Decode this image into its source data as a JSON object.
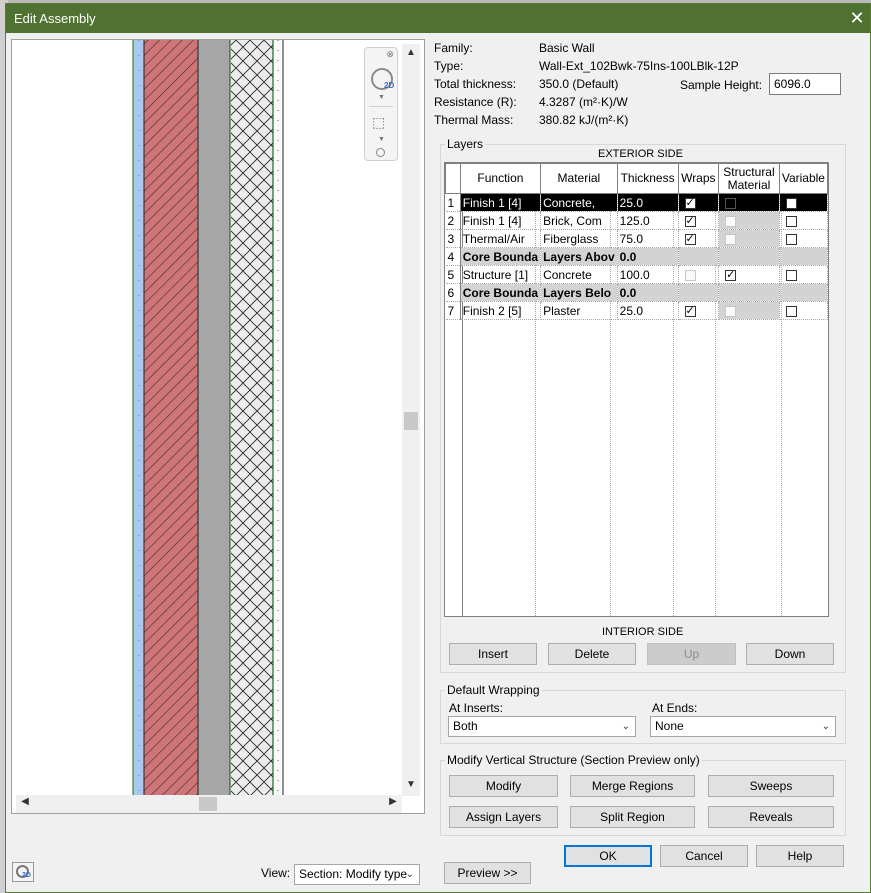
{
  "dialog": {
    "title": "Edit Assembly",
    "close_glyph": "✕"
  },
  "properties": {
    "family_label": "Family:",
    "family_value": "Basic Wall",
    "type_label": "Type:",
    "type_value": "Wall-Ext_102Bwk-75Ins-100LBlk-12P",
    "thickness_label": "Total thickness:",
    "thickness_value": "350.0 (Default)",
    "resistance_label": "Resistance (R):",
    "resistance_value": "4.3287 (m²·K)/W",
    "mass_label": "Thermal Mass:",
    "mass_value": "380.82 kJ/(m²·K)",
    "sample_height_label": "Sample Height:",
    "sample_height_value": "6096.0"
  },
  "layers": {
    "group_title": "Layers",
    "exterior_side": "EXTERIOR SIDE",
    "interior_side": "INTERIOR SIDE",
    "columns": [
      "Function",
      "Material",
      "Thickness",
      "Wraps",
      "Structural Material",
      "Variable"
    ],
    "rows": [
      {
        "num": "1",
        "function": "Finish 1 [4]",
        "material": "Concrete,",
        "thickness": "25.0",
        "wraps": true,
        "structural": false,
        "variable": false,
        "selected": true
      },
      {
        "num": "2",
        "function": "Finish 1 [4]",
        "material": "Brick, Com",
        "thickness": "125.0",
        "wraps": true,
        "structural": false,
        "variable": false
      },
      {
        "num": "3",
        "function": "Thermal/Air",
        "material": "Fiberglass",
        "thickness": "75.0",
        "wraps": true,
        "structural": false,
        "variable": false
      },
      {
        "num": "4",
        "function": "Core Bounda",
        "material": "Layers Abov",
        "thickness": "0.0",
        "core": true
      },
      {
        "num": "5",
        "function": "Structure [1]",
        "material": "Concrete",
        "thickness": "100.0",
        "wraps": false,
        "structural": true,
        "variable": false,
        "wraps_disabled": true
      },
      {
        "num": "6",
        "function": "Core Bounda",
        "material": "Layers Belo",
        "thickness": "0.0",
        "core": true
      },
      {
        "num": "7",
        "function": "Finish 2 [5]",
        "material": "Plaster",
        "thickness": "25.0",
        "wraps": true,
        "structural": false,
        "variable": false
      }
    ],
    "buttons": {
      "insert": "Insert",
      "delete": "Delete",
      "up": "Up",
      "down": "Down"
    }
  },
  "wrapping": {
    "group_title": "Default Wrapping",
    "inserts_label": "At Inserts:",
    "inserts_value": "Both",
    "ends_label": "At Ends:",
    "ends_value": "None"
  },
  "vertical": {
    "group_title": "Modify Vertical Structure (Section Preview only)",
    "buttons": {
      "modify": "Modify",
      "merge": "Merge Regions",
      "sweeps": "Sweeps",
      "assign": "Assign Layers",
      "split": "Split Region",
      "reveals": "Reveals"
    }
  },
  "footer": {
    "ok": "OK",
    "cancel": "Cancel",
    "help": "Help",
    "view_label": "View:",
    "view_value": "Section: Modify type",
    "preview": "Preview >>"
  },
  "nav": {
    "badge": "2D"
  }
}
